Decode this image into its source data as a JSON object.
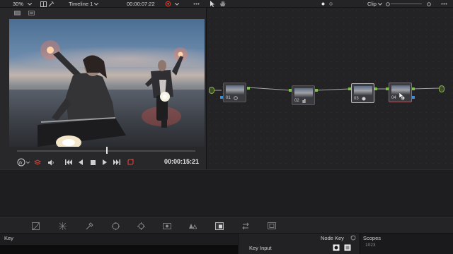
{
  "viewer_toolbar": {
    "zoom": "30%",
    "timeline_name": "Timeline 1",
    "timecode": "00:00:07:22"
  },
  "node_toolbar": {
    "mode": "Clip"
  },
  "nodes": [
    {
      "label": "01"
    },
    {
      "label": "02"
    },
    {
      "label": "03"
    },
    {
      "label": "04"
    }
  ],
  "transport": {
    "timecode": "00:00:15:21"
  },
  "key_panel": {
    "title": "Key",
    "node_key_label": "Node Key",
    "key_input_label": "Key Input",
    "scopes_label": "Scopes",
    "scope_value": "1023"
  },
  "colors": {
    "accent": "#e0443b",
    "port_green": "#7bc043",
    "port_blue": "#3c8fdc"
  }
}
